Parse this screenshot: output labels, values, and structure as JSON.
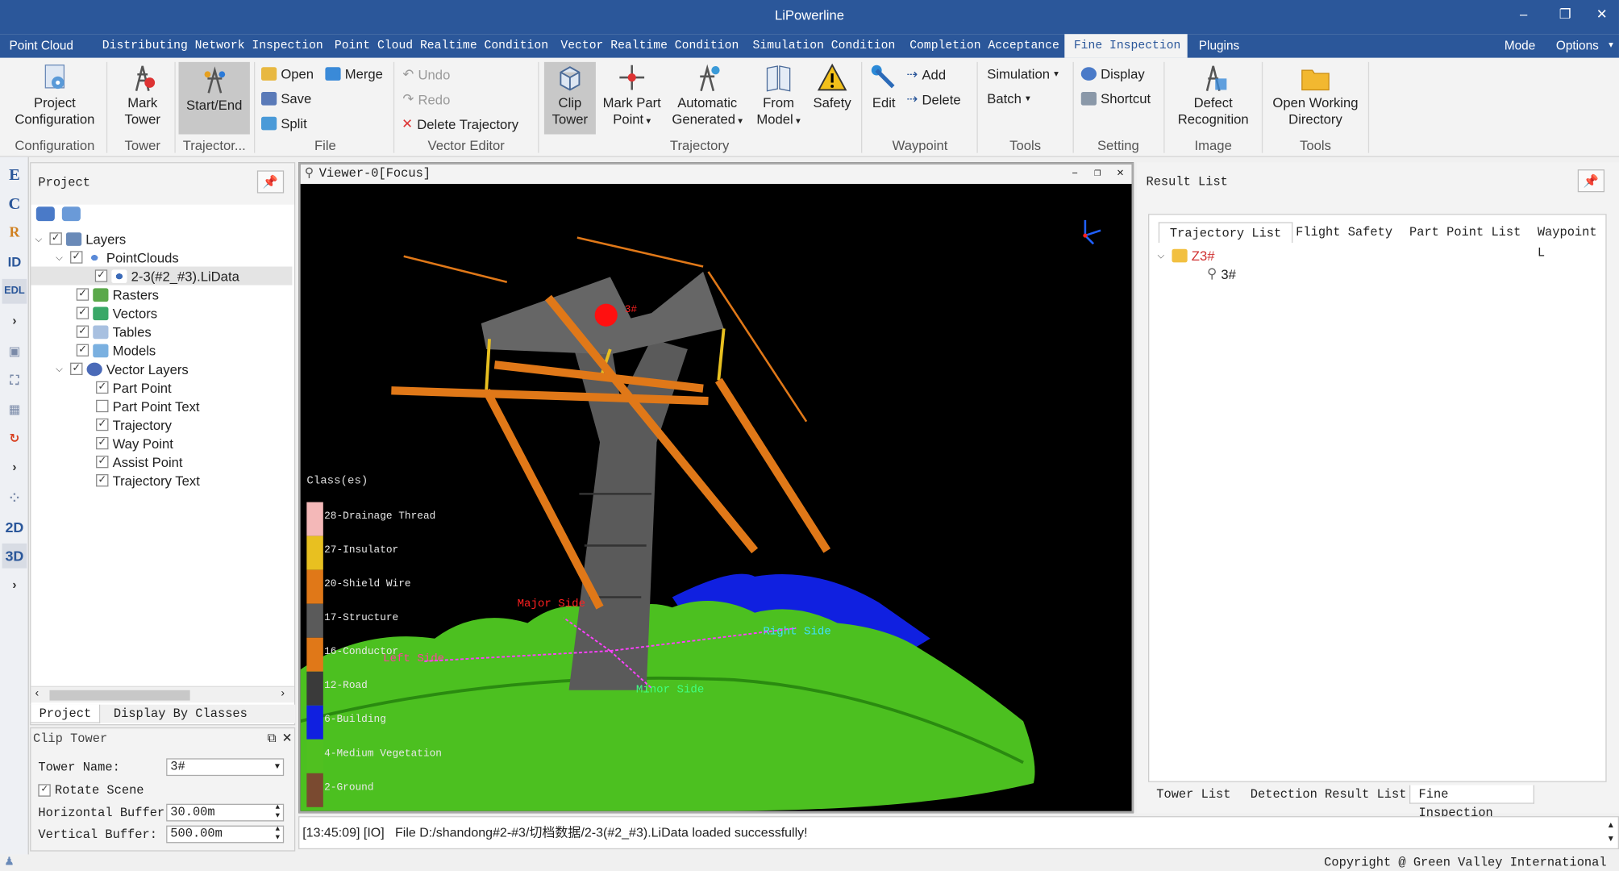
{
  "window": {
    "title": "LiPowerline"
  },
  "menu": {
    "tabs": [
      "Point Cloud",
      "Distributing Network Inspection",
      "Point Cloud Realtime Condition",
      "Vector Realtime Condition",
      "Simulation Condition",
      "Completion Acceptance",
      "Fine Inspection",
      "Plugins"
    ],
    "active": "Fine Inspection",
    "mode": "Mode",
    "options": "Options"
  },
  "ribbon": {
    "project_configuration": "Project Configuration",
    "mark_tower": "Mark Tower",
    "start_end": "Start/End",
    "open": "Open",
    "merge": "Merge",
    "save": "Save",
    "split": "Split",
    "undo": "Undo",
    "redo": "Redo",
    "delete_trajectory": "Delete Trajectory",
    "clip_tower": "Clip Tower",
    "mark_part_point": "Mark Part Point",
    "automatic_generated": "Automatic Generated",
    "from_model": "From Model",
    "safety": "Safety",
    "edit": "Edit",
    "add": "Add",
    "delete": "Delete",
    "simulation": "Simulation",
    "batch": "Batch",
    "display": "Display",
    "shortcut": "Shortcut",
    "defect_recognition": "Defect Recognition",
    "open_working_directory": "Open Working Directory",
    "groups": {
      "configuration": "Configuration",
      "tower": "Tower",
      "trajectory_short": "Trajector...",
      "file": "File",
      "vector_editor": "Vector Editor",
      "trajectory": "Trajectory",
      "waypoint": "Waypoint",
      "tools": "Tools",
      "setting": "Setting",
      "image": "Image",
      "tools2": "Tools"
    }
  },
  "left_toolbar": [
    "E",
    "C",
    "R",
    "ID",
    "EDL",
    "2D",
    "3D"
  ],
  "project": {
    "title": "Project",
    "tree": [
      {
        "label": "Layers",
        "checked": true,
        "level": 0
      },
      {
        "label": "PointClouds",
        "checked": true,
        "level": 1
      },
      {
        "label": "2-3(#2_#3).LiData",
        "checked": true,
        "level": 2
      },
      {
        "label": "Rasters",
        "checked": true,
        "level": 1
      },
      {
        "label": "Vectors",
        "checked": true,
        "level": 1
      },
      {
        "label": "Tables",
        "checked": true,
        "level": 1
      },
      {
        "label": "Models",
        "checked": true,
        "level": 1
      },
      {
        "label": "Vector Layers",
        "checked": true,
        "level": 1
      },
      {
        "label": "Part Point",
        "checked": true,
        "level": 2
      },
      {
        "label": "Part Point Text",
        "checked": false,
        "level": 2
      },
      {
        "label": "Trajectory",
        "checked": true,
        "level": 2
      },
      {
        "label": "Way Point",
        "checked": true,
        "level": 2
      },
      {
        "label": "Assist Point",
        "checked": true,
        "level": 2
      },
      {
        "label": "Trajectory Text",
        "checked": true,
        "level": 2
      }
    ],
    "tabs": [
      "Project",
      "Display By Classes"
    ]
  },
  "clip_tower": {
    "title": "Clip Tower",
    "tower_name_label": "Tower Name:",
    "tower_name": "3#",
    "rotate_scene": "Rotate Scene",
    "rotate_checked": true,
    "horizontal_buffer_label": "Horizontal Buffer:",
    "horizontal_buffer": "30.00m",
    "vertical_buffer_label": "Vertical Buffer:",
    "vertical_buffer": "500.00m"
  },
  "viewer": {
    "title": "Viewer-0[Focus]",
    "legend_title": "Class(es)",
    "classes": [
      {
        "label": "28-Drainage Thread",
        "color": "#f4b8b8"
      },
      {
        "label": "27-Insulator",
        "color": "#e8c020"
      },
      {
        "label": "20-Shield Wire",
        "color": "#e07818"
      },
      {
        "label": "17-Structure",
        "color": "#5a5a5a"
      },
      {
        "label": "16-Conductor",
        "color": "#e07818"
      },
      {
        "label": "12-Road",
        "color": "#3a3a3a"
      },
      {
        "label": "6-Building",
        "color": "#1020e0"
      },
      {
        "label": "4-Medium Vegetation",
        "color": "#50c020"
      },
      {
        "label": "2-Ground",
        "color": "#7a4a30"
      }
    ],
    "tower_label": "3#",
    "major_side": "Major Side",
    "minor_side": "Minor Side",
    "left_side": "Left Side",
    "right_side": "Right Side"
  },
  "result": {
    "title": "Result List",
    "tabs": [
      "Trajectory List",
      "Flight Safety",
      "Part Point List",
      "Waypoint L"
    ],
    "tree": [
      {
        "label": "Z3#",
        "level": 0
      },
      {
        "label": "3#",
        "level": 1
      }
    ],
    "bottom_tabs": [
      "Tower List",
      "Detection Result List",
      "Fine Inspection"
    ]
  },
  "status": {
    "log": "[13:45:09] [IO]   File D:/shandong#2-#3/切档数据/2-3(#2_#3).LiData loaded successfully!"
  },
  "footer": {
    "copyright": "Copyright @ Green Valley International"
  }
}
